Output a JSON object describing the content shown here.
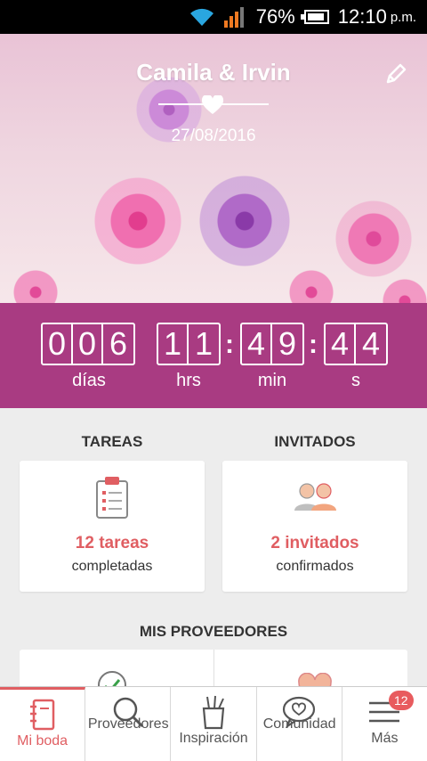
{
  "status_bar": {
    "battery": "76%",
    "time": "12:10",
    "ampm": "p.m.",
    "battery_level": 0.76
  },
  "hero": {
    "couple": "Camila & Irvin",
    "date": "27/08/2016"
  },
  "countdown": {
    "days": [
      "0",
      "0",
      "6"
    ],
    "hours": [
      "1",
      "1"
    ],
    "minutes": [
      "4",
      "9"
    ],
    "seconds": [
      "4",
      "4"
    ],
    "labels": {
      "days": "días",
      "hours": "hrs",
      "minutes": "min",
      "seconds": "s"
    }
  },
  "tareas": {
    "title": "TAREAS",
    "count": "12 tareas",
    "subtitle": "completadas"
  },
  "invitados": {
    "title": "INVITADOS",
    "count": "2 invitados",
    "subtitle": "confirmados"
  },
  "proveedores": {
    "title": "MIS PROVEEDORES"
  },
  "nav": {
    "items": [
      {
        "label": "Mi boda"
      },
      {
        "label": "Proveedores"
      },
      {
        "label": "Inspiración"
      },
      {
        "label": "Comunidad"
      },
      {
        "label": "Más"
      }
    ],
    "badge": "12"
  },
  "colors": {
    "accent": "#a93b82",
    "highlight": "#e05e62"
  }
}
